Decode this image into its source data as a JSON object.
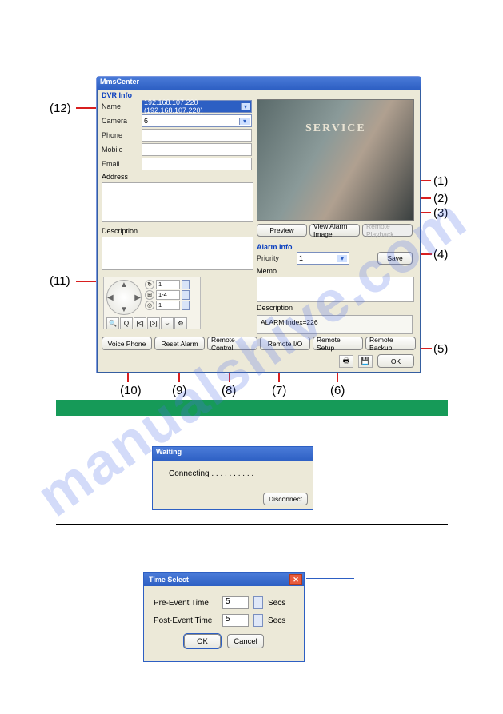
{
  "watermark": "manualshive.com",
  "main": {
    "title": "MmsCenter",
    "dvr_info_label": "DVR Info",
    "fields": {
      "name": "Name",
      "camera": "Camera",
      "phone": "Phone",
      "mobile": "Mobile",
      "email": "Email",
      "address": "Address",
      "description": "Description"
    },
    "name_value": "192.168.107.220 (192.168.107.220)",
    "camera_value": "6",
    "service_sign": "SERVICE",
    "buttons": {
      "preview": "Preview",
      "view_alarm_image": "View Alarm Image",
      "remote_playback": "Remote Playback",
      "save": "Save",
      "voice_phone": "Voice Phone",
      "reset_alarm": "Reset Alarm",
      "remote_control": "Remote Control",
      "remote_io": "Remote I/O",
      "remote_setup": "Remote Setup",
      "remote_backup": "Remote Backup",
      "ok": "OK"
    },
    "alarm": {
      "label": "Alarm Info",
      "priority_label": "Priority",
      "priority_value": "1",
      "memo_label": "Memo",
      "desc_label": "Description",
      "desc_value": "ALARM Index=226"
    },
    "ptz": {
      "spin1": "1",
      "spin2": "1-4",
      "spin3": "1"
    }
  },
  "waiting": {
    "title": "Waiting",
    "msg": "Connecting . . . . . . . . . .",
    "disconnect": "Disconnect"
  },
  "timesel": {
    "title": "Time Select",
    "pre_label": "Pre-Event Time",
    "post_label": "Post-Event Time",
    "pre_value": "5",
    "post_value": "5",
    "secs": "Secs",
    "ok": "OK",
    "cancel": "Cancel"
  },
  "callouts": {
    "c1": "(1)",
    "c2": "(2)",
    "c3": "(3)",
    "c4": "(4)",
    "c5": "(5)",
    "c6": "(6)",
    "c7": "(7)",
    "c8": "(8)",
    "c9": "(9)",
    "c10": "(10)",
    "c11": "(11)",
    "c12": "(12)"
  }
}
